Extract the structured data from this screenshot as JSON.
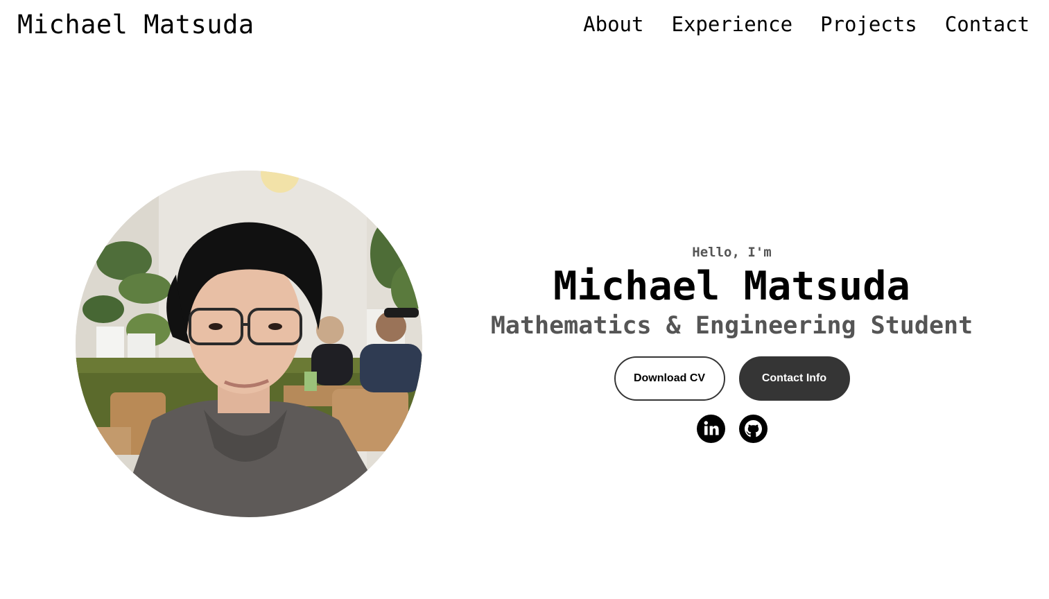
{
  "header": {
    "logo": "Michael Matsuda",
    "nav": [
      {
        "label": "About"
      },
      {
        "label": "Experience"
      },
      {
        "label": "Projects"
      },
      {
        "label": "Contact"
      }
    ]
  },
  "hero": {
    "greeting": "Hello, I'm",
    "name": "Michael Matsuda",
    "title": "Mathematics & Engineering Student",
    "buttons": {
      "download_cv": "Download CV",
      "contact_info": "Contact Info"
    },
    "socials": [
      {
        "icon": "linkedin-icon"
      },
      {
        "icon": "github-icon"
      }
    ],
    "profile_image": {
      "icon": "profile-photo"
    }
  },
  "colors": {
    "text": "#000000",
    "muted": "#555555",
    "button_dark": "#353535",
    "background": "#ffffff"
  }
}
